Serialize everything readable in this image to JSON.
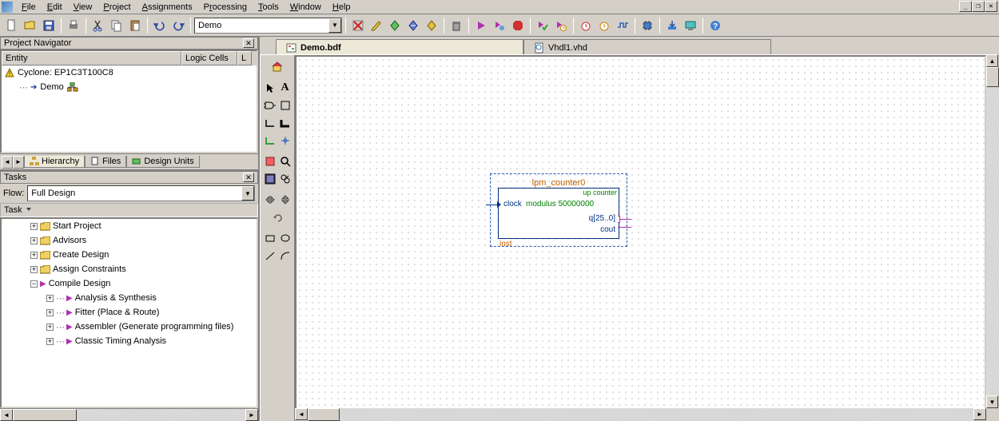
{
  "menu": [
    "File",
    "Edit",
    "View",
    "Project",
    "Assignments",
    "Processing",
    "Tools",
    "Window",
    "Help"
  ],
  "toolbar_combo": "Demo",
  "nav": {
    "title": "Project Navigator",
    "columns": [
      "Entity",
      "Logic Cells",
      "L"
    ],
    "device": "Cyclone: EP1C3T100C8",
    "top_entity": "Demo",
    "tabs": [
      "Hierarchy",
      "Files",
      "Design Units"
    ]
  },
  "tasks": {
    "title": "Tasks",
    "flow_label": "Flow:",
    "flow_value": "Full Design",
    "header": "Task",
    "items": [
      {
        "label": "Start Project",
        "expanded": false
      },
      {
        "label": "Advisors",
        "expanded": false
      },
      {
        "label": "Create Design",
        "expanded": false
      },
      {
        "label": "Assign Constraints",
        "expanded": false
      },
      {
        "label": "Compile Design",
        "expanded": true,
        "children": [
          {
            "label": "Analysis & Synthesis"
          },
          {
            "label": "Fitter (Place & Route)"
          },
          {
            "label": "Assembler (Generate programming files)"
          },
          {
            "label": "Classic Timing Analysis"
          }
        ]
      }
    ]
  },
  "file_tabs": [
    {
      "label": "Demo.bdf",
      "active": true,
      "icon": "bdf"
    },
    {
      "label": "Vhdl1.vhd",
      "active": false,
      "icon": "vhd"
    }
  ],
  "block": {
    "title": "lpm_counter0",
    "subtitle": "up counter",
    "clock_label": "clock",
    "modulus_label": "modulus",
    "modulus_value": "50000000",
    "q_label": "q[25..0]",
    "cout_label": "cout",
    "inst_label": "inst"
  }
}
